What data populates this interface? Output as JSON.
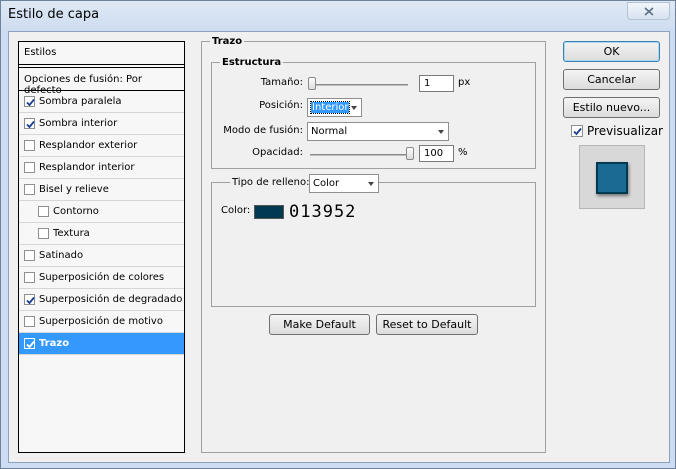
{
  "window": {
    "title": "Estilo de capa"
  },
  "colors": {
    "stroke_color": "#013952",
    "preview_fill": "#1b6a93",
    "selection": "#3399ff"
  },
  "styles": {
    "header": "Estilos",
    "blend_options": "Opciones de fusión: Por defecto",
    "items": [
      {
        "label": "Sombra paralela",
        "checked": true,
        "level": 0
      },
      {
        "label": "Sombra interior",
        "checked": true,
        "level": 0
      },
      {
        "label": "Resplandor exterior",
        "checked": false,
        "level": 0
      },
      {
        "label": "Resplandor interior",
        "checked": false,
        "level": 0
      },
      {
        "label": "Bisel y relieve",
        "checked": false,
        "level": 0
      },
      {
        "label": "Contorno",
        "checked": false,
        "level": 1
      },
      {
        "label": "Textura",
        "checked": false,
        "level": 1
      },
      {
        "label": "Satinado",
        "checked": false,
        "level": 0
      },
      {
        "label": "Superposición de colores",
        "checked": false,
        "level": 0
      },
      {
        "label": "Superposición de degradado",
        "checked": true,
        "level": 0
      },
      {
        "label": "Superposición de motivo",
        "checked": false,
        "level": 0
      },
      {
        "label": "Trazo",
        "checked": true,
        "level": 0,
        "selected": true
      }
    ]
  },
  "stroke": {
    "group_title": "Trazo",
    "structure_title": "Estructura",
    "size_label": "Tamaño:",
    "size_value": "1",
    "size_unit": "px",
    "size_slider_fraction": 0.0,
    "position_label": "Posición:",
    "position_value": "Interior",
    "blend_mode_label": "Modo de fusión:",
    "blend_mode_value": "Normal",
    "opacity_label": "Opacidad:",
    "opacity_value": "100",
    "opacity_unit": "%",
    "opacity_slider_fraction": 1.0,
    "fill_type_label": "Tipo de relleno:",
    "fill_type_value": "Color",
    "color_label": "Color:",
    "color_hex_text": "013952"
  },
  "buttons": {
    "make_default": "Make Default",
    "reset_default": "Reset to Default",
    "ok": "OK",
    "cancel": "Cancelar",
    "new_style": "Estilo nuevo...",
    "preview_label": "Previsualizar",
    "preview_checked": true
  }
}
